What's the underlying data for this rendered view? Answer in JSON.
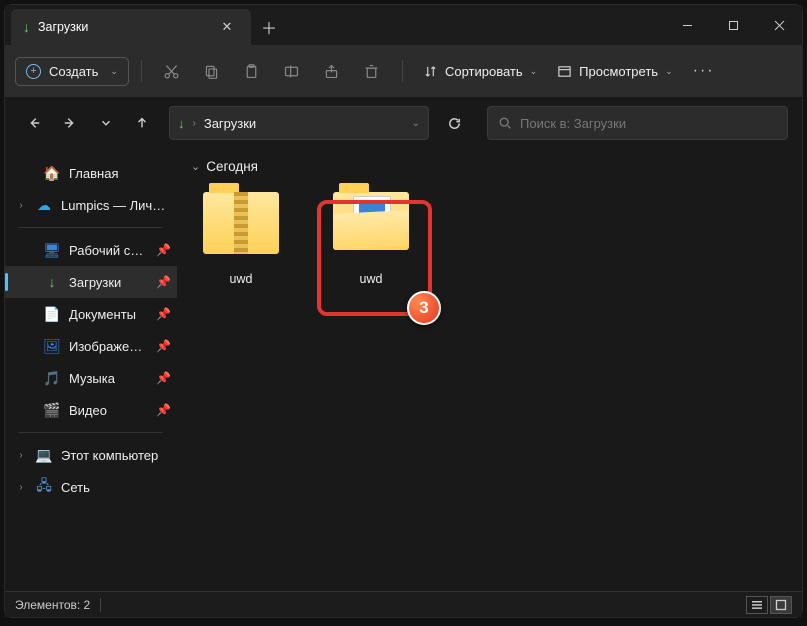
{
  "tab": {
    "title": "Загрузки"
  },
  "toolbar": {
    "create_label": "Создать",
    "sort_label": "Сортировать",
    "view_label": "Просмотреть"
  },
  "address": {
    "crumb": "Загрузки"
  },
  "search": {
    "placeholder": "Поиск в: Загрузки"
  },
  "sidebar": {
    "home": "Главная",
    "onedrive": "Lumpics — Личное",
    "desktop": "Рабочий стол",
    "downloads": "Загрузки",
    "documents": "Документы",
    "pictures": "Изображения",
    "music": "Музыка",
    "videos": "Видео",
    "this_pc": "Этот компьютер",
    "network": "Сеть"
  },
  "content": {
    "group_today": "Сегодня",
    "items": [
      {
        "name": "uwd",
        "type": "zip"
      },
      {
        "name": "uwd",
        "type": "folder"
      }
    ]
  },
  "annotation": {
    "badge_number": "3"
  },
  "statusbar": {
    "count_label": "Элементов: 2"
  }
}
